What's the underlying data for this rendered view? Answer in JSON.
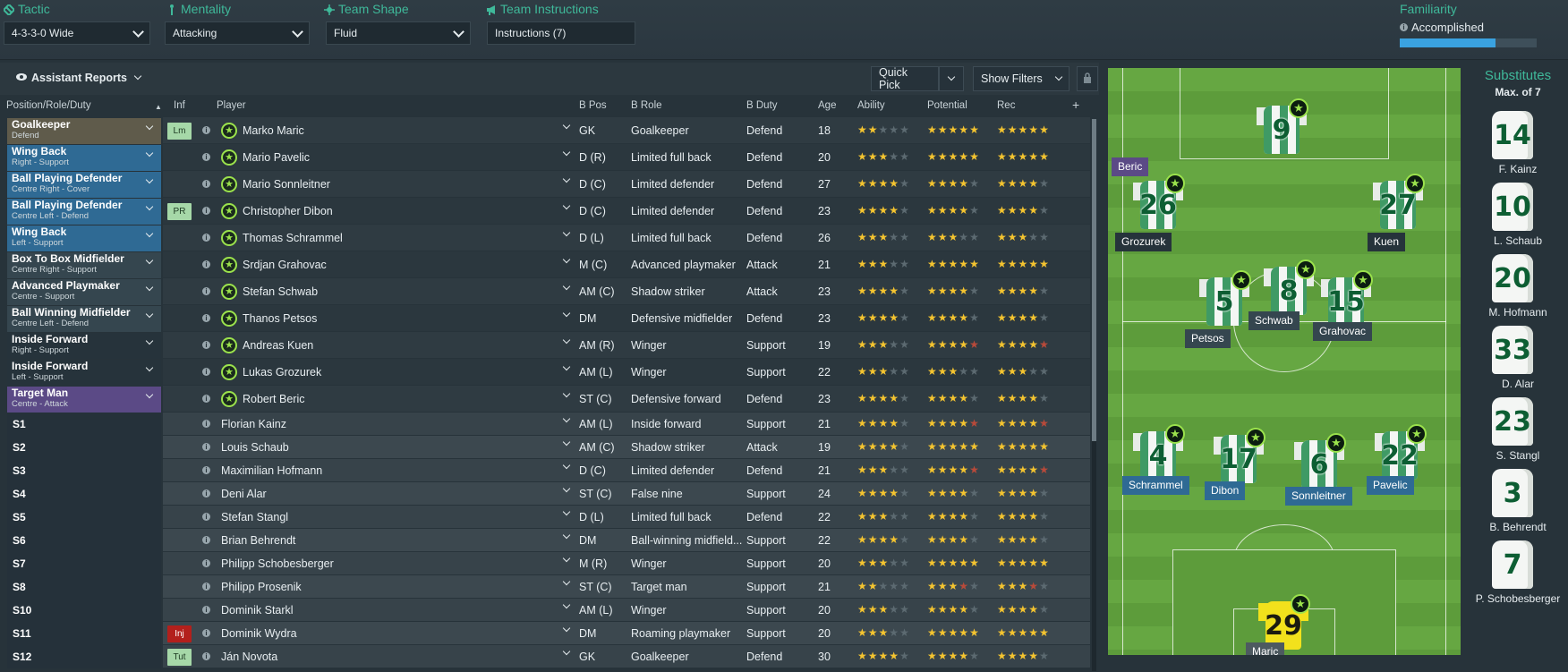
{
  "topbar": {
    "tactic": {
      "label": "Tactic",
      "value": "4-3-3-0 Wide"
    },
    "mentality": {
      "label": "Mentality",
      "value": "Attacking"
    },
    "team_shape": {
      "label": "Team Shape",
      "value": "Fluid"
    },
    "team_instructions": {
      "label": "Team Instructions",
      "value": "Instructions (7)"
    },
    "familiarity": {
      "label": "Familiarity",
      "value": "Accomplished",
      "level": 0.7
    }
  },
  "toolbar": {
    "assistant_reports": "Assistant Reports",
    "quick_pick": "Quick Pick",
    "show_filters": "Show Filters"
  },
  "columns": {
    "position": "Position/Role/Duty",
    "inf": "Inf",
    "player": "Player",
    "bpos": "B Pos",
    "brole": "B Role",
    "bduty": "B Duty",
    "age": "Age",
    "ability": "Ability",
    "potential": "Potential",
    "rec": "Rec"
  },
  "roles": [
    {
      "name": "Goalkeeper",
      "sub": "Defend",
      "color": "#5f5b4b"
    },
    {
      "name": "Wing Back",
      "sub": "Right - Support",
      "color": "#2f6a94"
    },
    {
      "name": "Ball Playing Defender",
      "sub": "Centre Right - Cover",
      "color": "#2f6a94"
    },
    {
      "name": "Ball Playing Defender",
      "sub": "Centre Left - Defend",
      "color": "#2f6a94"
    },
    {
      "name": "Wing Back",
      "sub": "Left - Support",
      "color": "#2f6a94"
    },
    {
      "name": "Box To Box Midfielder",
      "sub": "Centre Right - Support",
      "color": "#35464f"
    },
    {
      "name": "Advanced Playmaker",
      "sub": "Centre - Support",
      "color": "#35464f"
    },
    {
      "name": "Ball Winning Midfielder",
      "sub": "Centre Left - Defend",
      "color": "#35464f"
    },
    {
      "name": "Inside Forward",
      "sub": "Right - Support",
      "color": "#26333b"
    },
    {
      "name": "Inside Forward",
      "sub": "Left - Support",
      "color": "#26333b"
    },
    {
      "name": "Target Man",
      "sub": "Centre - Attack",
      "color": "#5b4a86"
    }
  ],
  "sub_slots": [
    "S1",
    "S2",
    "S3",
    "S4",
    "S5",
    "S6",
    "S7",
    "S8",
    "S10",
    "S11",
    "S12"
  ],
  "players": [
    {
      "inf": "Lm",
      "name": "Marko Maric",
      "bpos": "GK",
      "brole": "Goalkeeper",
      "bduty": "Defend",
      "age": "18",
      "ability": "2",
      "potential": "4.5",
      "rec": "4.5"
    },
    {
      "inf": "",
      "name": "Mario Pavelic",
      "bpos": "D (R)",
      "brole": "Limited full back",
      "bduty": "Defend",
      "age": "20",
      "ability": "3",
      "potential": "4.5",
      "rec": "4.5"
    },
    {
      "inf": "",
      "name": "Mario Sonnleitner",
      "bpos": "D (C)",
      "brole": "Limited defender",
      "bduty": "Defend",
      "age": "27",
      "ability": "3.5",
      "potential": "3.5",
      "rec": "3.5"
    },
    {
      "inf": "PR",
      "name": "Christopher Dibon",
      "bpos": "D (C)",
      "brole": "Limited defender",
      "bduty": "Defend",
      "age": "23",
      "ability": "3.5",
      "potential": "4",
      "rec": "4"
    },
    {
      "inf": "",
      "name": "Thomas Schrammel",
      "bpos": "D (L)",
      "brole": "Limited full back",
      "bduty": "Defend",
      "age": "26",
      "ability": "3",
      "potential": "3",
      "rec": "3"
    },
    {
      "inf": "",
      "name": "Srdjan Grahovac",
      "bpos": "M (C)",
      "brole": "Advanced playmaker",
      "bduty": "Attack",
      "age": "21",
      "ability": "3",
      "potential": "4.5",
      "rec": "4.5"
    },
    {
      "inf": "",
      "name": "Stefan Schwab",
      "bpos": "AM (C)",
      "brole": "Shadow striker",
      "bduty": "Attack",
      "age": "23",
      "ability": "3.5",
      "potential": "4",
      "rec": "4"
    },
    {
      "inf": "",
      "name": "Thanos Petsos",
      "bpos": "DM",
      "brole": "Defensive midfielder",
      "bduty": "Defend",
      "age": "23",
      "ability": "4",
      "potential": "4",
      "rec": "4"
    },
    {
      "inf": "",
      "name": "Andreas Kuen",
      "bpos": "AM (R)",
      "brole": "Winger",
      "bduty": "Support",
      "age": "19",
      "ability": "2.5",
      "potential": "3.5r",
      "rec": "3.5r"
    },
    {
      "inf": "",
      "name": "Lukas Grozurek",
      "bpos": "AM (L)",
      "brole": "Winger",
      "bduty": "Support",
      "age": "22",
      "ability": "3",
      "potential": "3",
      "rec": "3"
    },
    {
      "inf": "",
      "name": "Robert Beric",
      "bpos": "ST (C)",
      "brole": "Defensive forward",
      "bduty": "Defend",
      "age": "23",
      "ability": "3.5",
      "potential": "4",
      "rec": "4"
    },
    {
      "inf": "",
      "name": "Florian Kainz",
      "bpos": "AM (L)",
      "brole": "Inside forward",
      "bduty": "Support",
      "age": "21",
      "ability": "3.5",
      "potential": "3.5r",
      "rec": "3.5r"
    },
    {
      "inf": "",
      "name": "Louis Schaub",
      "bpos": "AM (C)",
      "brole": "Shadow striker",
      "bduty": "Attack",
      "age": "19",
      "ability": "3.5",
      "potential": "4.5",
      "rec": "4.5"
    },
    {
      "inf": "",
      "name": "Maximilian Hofmann",
      "bpos": "D (C)",
      "brole": "Limited defender",
      "bduty": "Defend",
      "age": "21",
      "ability": "2.5",
      "potential": "3.5r",
      "rec": "3.5r"
    },
    {
      "inf": "",
      "name": "Deni Alar",
      "bpos": "ST (C)",
      "brole": "False nine",
      "bduty": "Support",
      "age": "24",
      "ability": "3.5",
      "potential": "3.5",
      "rec": "3.5"
    },
    {
      "inf": "",
      "name": "Stefan Stangl",
      "bpos": "D (L)",
      "brole": "Limited full back",
      "bduty": "Defend",
      "age": "22",
      "ability": "2.5",
      "potential": "3.5",
      "rec": "3.5"
    },
    {
      "inf": "",
      "name": "Brian Behrendt",
      "bpos": "DM",
      "brole": "Ball-winning midfield...",
      "bduty": "Support",
      "age": "22",
      "ability": "3.5",
      "potential": "3.5",
      "rec": "3.5"
    },
    {
      "inf": "",
      "name": "Philipp Schobesberger",
      "bpos": "M (R)",
      "brole": "Winger",
      "bduty": "Support",
      "age": "20",
      "ability": "3",
      "potential": "4.5",
      "rec": "4.5"
    },
    {
      "inf": "",
      "name": "Philipp Prosenik",
      "bpos": "ST (C)",
      "brole": "Target man",
      "bduty": "Support",
      "age": "21",
      "ability": "2",
      "potential": "2.5r",
      "rec": "2.5r"
    },
    {
      "inf": "",
      "name": "Dominik Starkl",
      "bpos": "AM (L)",
      "brole": "Winger",
      "bduty": "Support",
      "age": "20",
      "ability": "2.5",
      "potential": "3.5",
      "rec": "3.5"
    },
    {
      "inf": "Inj",
      "name": "Dominik Wydra",
      "bpos": "DM",
      "brole": "Roaming playmaker",
      "bduty": "Support",
      "age": "20",
      "ability": "3",
      "potential": "4.5",
      "rec": "4.5"
    },
    {
      "inf": "Tut",
      "name": "Ján Novota",
      "bpos": "GK",
      "brole": "Goalkeeper",
      "bduty": "Defend",
      "age": "30",
      "ability": "3.5",
      "potential": "4",
      "rec": "4"
    }
  ],
  "pitch": {
    "players": [
      {
        "num": "9",
        "name": "Beric",
        "label_color": "#5b4a86"
      },
      {
        "num": "26",
        "name": "Grozurek",
        "label_color": "#26333b"
      },
      {
        "num": "27",
        "name": "Kuen",
        "label_color": "#26333b"
      },
      {
        "num": "5",
        "name": "Petsos",
        "label_color": "#35464f"
      },
      {
        "num": "8",
        "name": "Schwab",
        "label_color": "#35464f"
      },
      {
        "num": "15",
        "name": "Grahovac",
        "label_color": "#35464f"
      },
      {
        "num": "4",
        "name": "Schrammel",
        "label_color": "#2f6a94"
      },
      {
        "num": "17",
        "name": "Dibon",
        "label_color": "#2f6a94"
      },
      {
        "num": "6",
        "name": "Sonnleitner",
        "label_color": "#2f6a94"
      },
      {
        "num": "22",
        "name": "Pavelic",
        "label_color": "#2f6a94"
      },
      {
        "num": "29",
        "name": "Maric",
        "label_color": "#5f5b4b"
      }
    ]
  },
  "substitutes": {
    "title": "Substitutes",
    "max": "Max. of 7",
    "players": [
      {
        "num": "14",
        "name": "F. Kainz"
      },
      {
        "num": "10",
        "name": "L. Schaub"
      },
      {
        "num": "20",
        "name": "M. Hofmann"
      },
      {
        "num": "33",
        "name": "D. Alar"
      },
      {
        "num": "23",
        "name": "S. Stangl"
      },
      {
        "num": "3",
        "name": "B. Behrendt"
      },
      {
        "num": "7",
        "name": "P. Schobesberger"
      }
    ]
  }
}
